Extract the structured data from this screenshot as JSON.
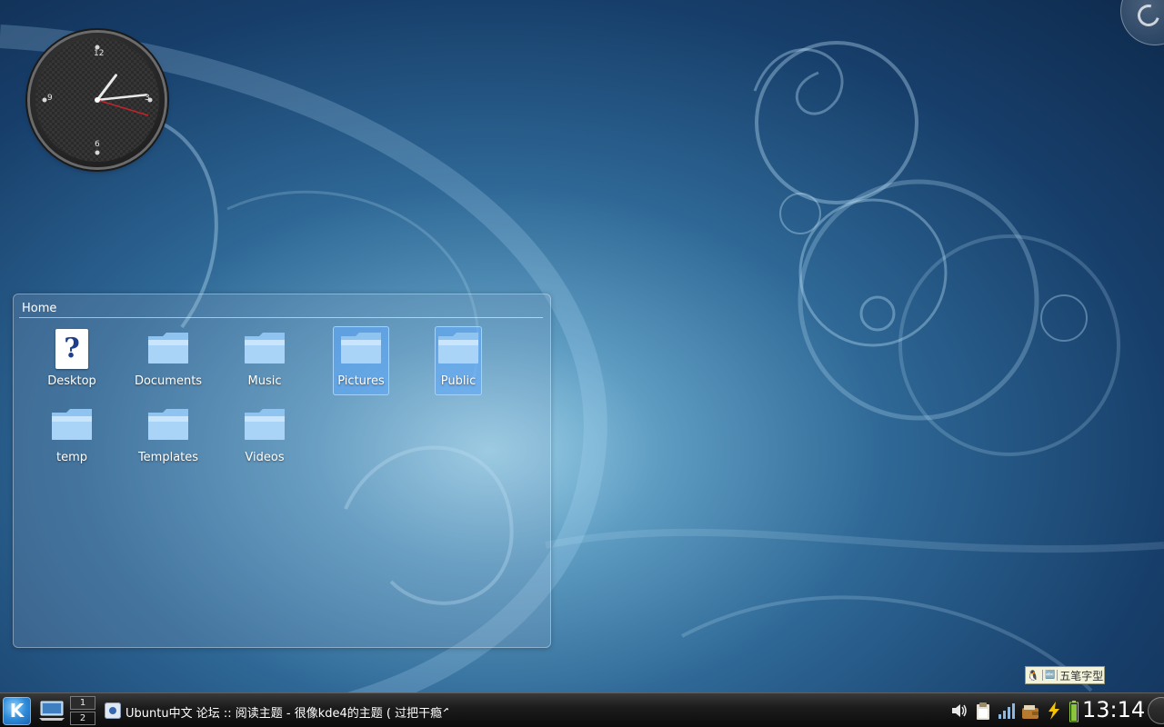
{
  "clock": {
    "numerals": [
      "12",
      "3",
      "6",
      "9"
    ],
    "hour": 13,
    "minute": 14
  },
  "folderview": {
    "title": "Home",
    "items": [
      {
        "label": "Desktop",
        "icon": "unknown-file-icon",
        "selected": false
      },
      {
        "label": "Documents",
        "icon": "folder-icon",
        "selected": false
      },
      {
        "label": "Music",
        "icon": "folder-icon",
        "selected": false
      },
      {
        "label": "Pictures",
        "icon": "folder-icon",
        "selected": true
      },
      {
        "label": "Public",
        "icon": "folder-icon",
        "selected": true
      },
      {
        "label": "temp",
        "icon": "folder-icon",
        "selected": false
      },
      {
        "label": "Templates",
        "icon": "folder-icon",
        "selected": false
      },
      {
        "label": "Videos",
        "icon": "folder-icon",
        "selected": false
      }
    ]
  },
  "ime": {
    "label": "五笔字型",
    "icon": "penguin-icon",
    "mode_glyph": "🔤"
  },
  "taskbar": {
    "kmenu_glyph": "K",
    "pager": [
      "1",
      "2"
    ],
    "task_label": "Ubuntu中文 论坛 :: 阅读主题 - 很像kde4的主题 ( 过把干瘾^",
    "tray_icons": [
      "volume-icon",
      "klipper-icon",
      "network-signal-icon",
      "wallet-icon",
      "power-icon"
    ],
    "time": "13:14"
  },
  "colors": {
    "selection": "#5faaff",
    "panel": "#111111",
    "background_dark": "#0e2a4c",
    "background_light": "#9fd3ea"
  }
}
